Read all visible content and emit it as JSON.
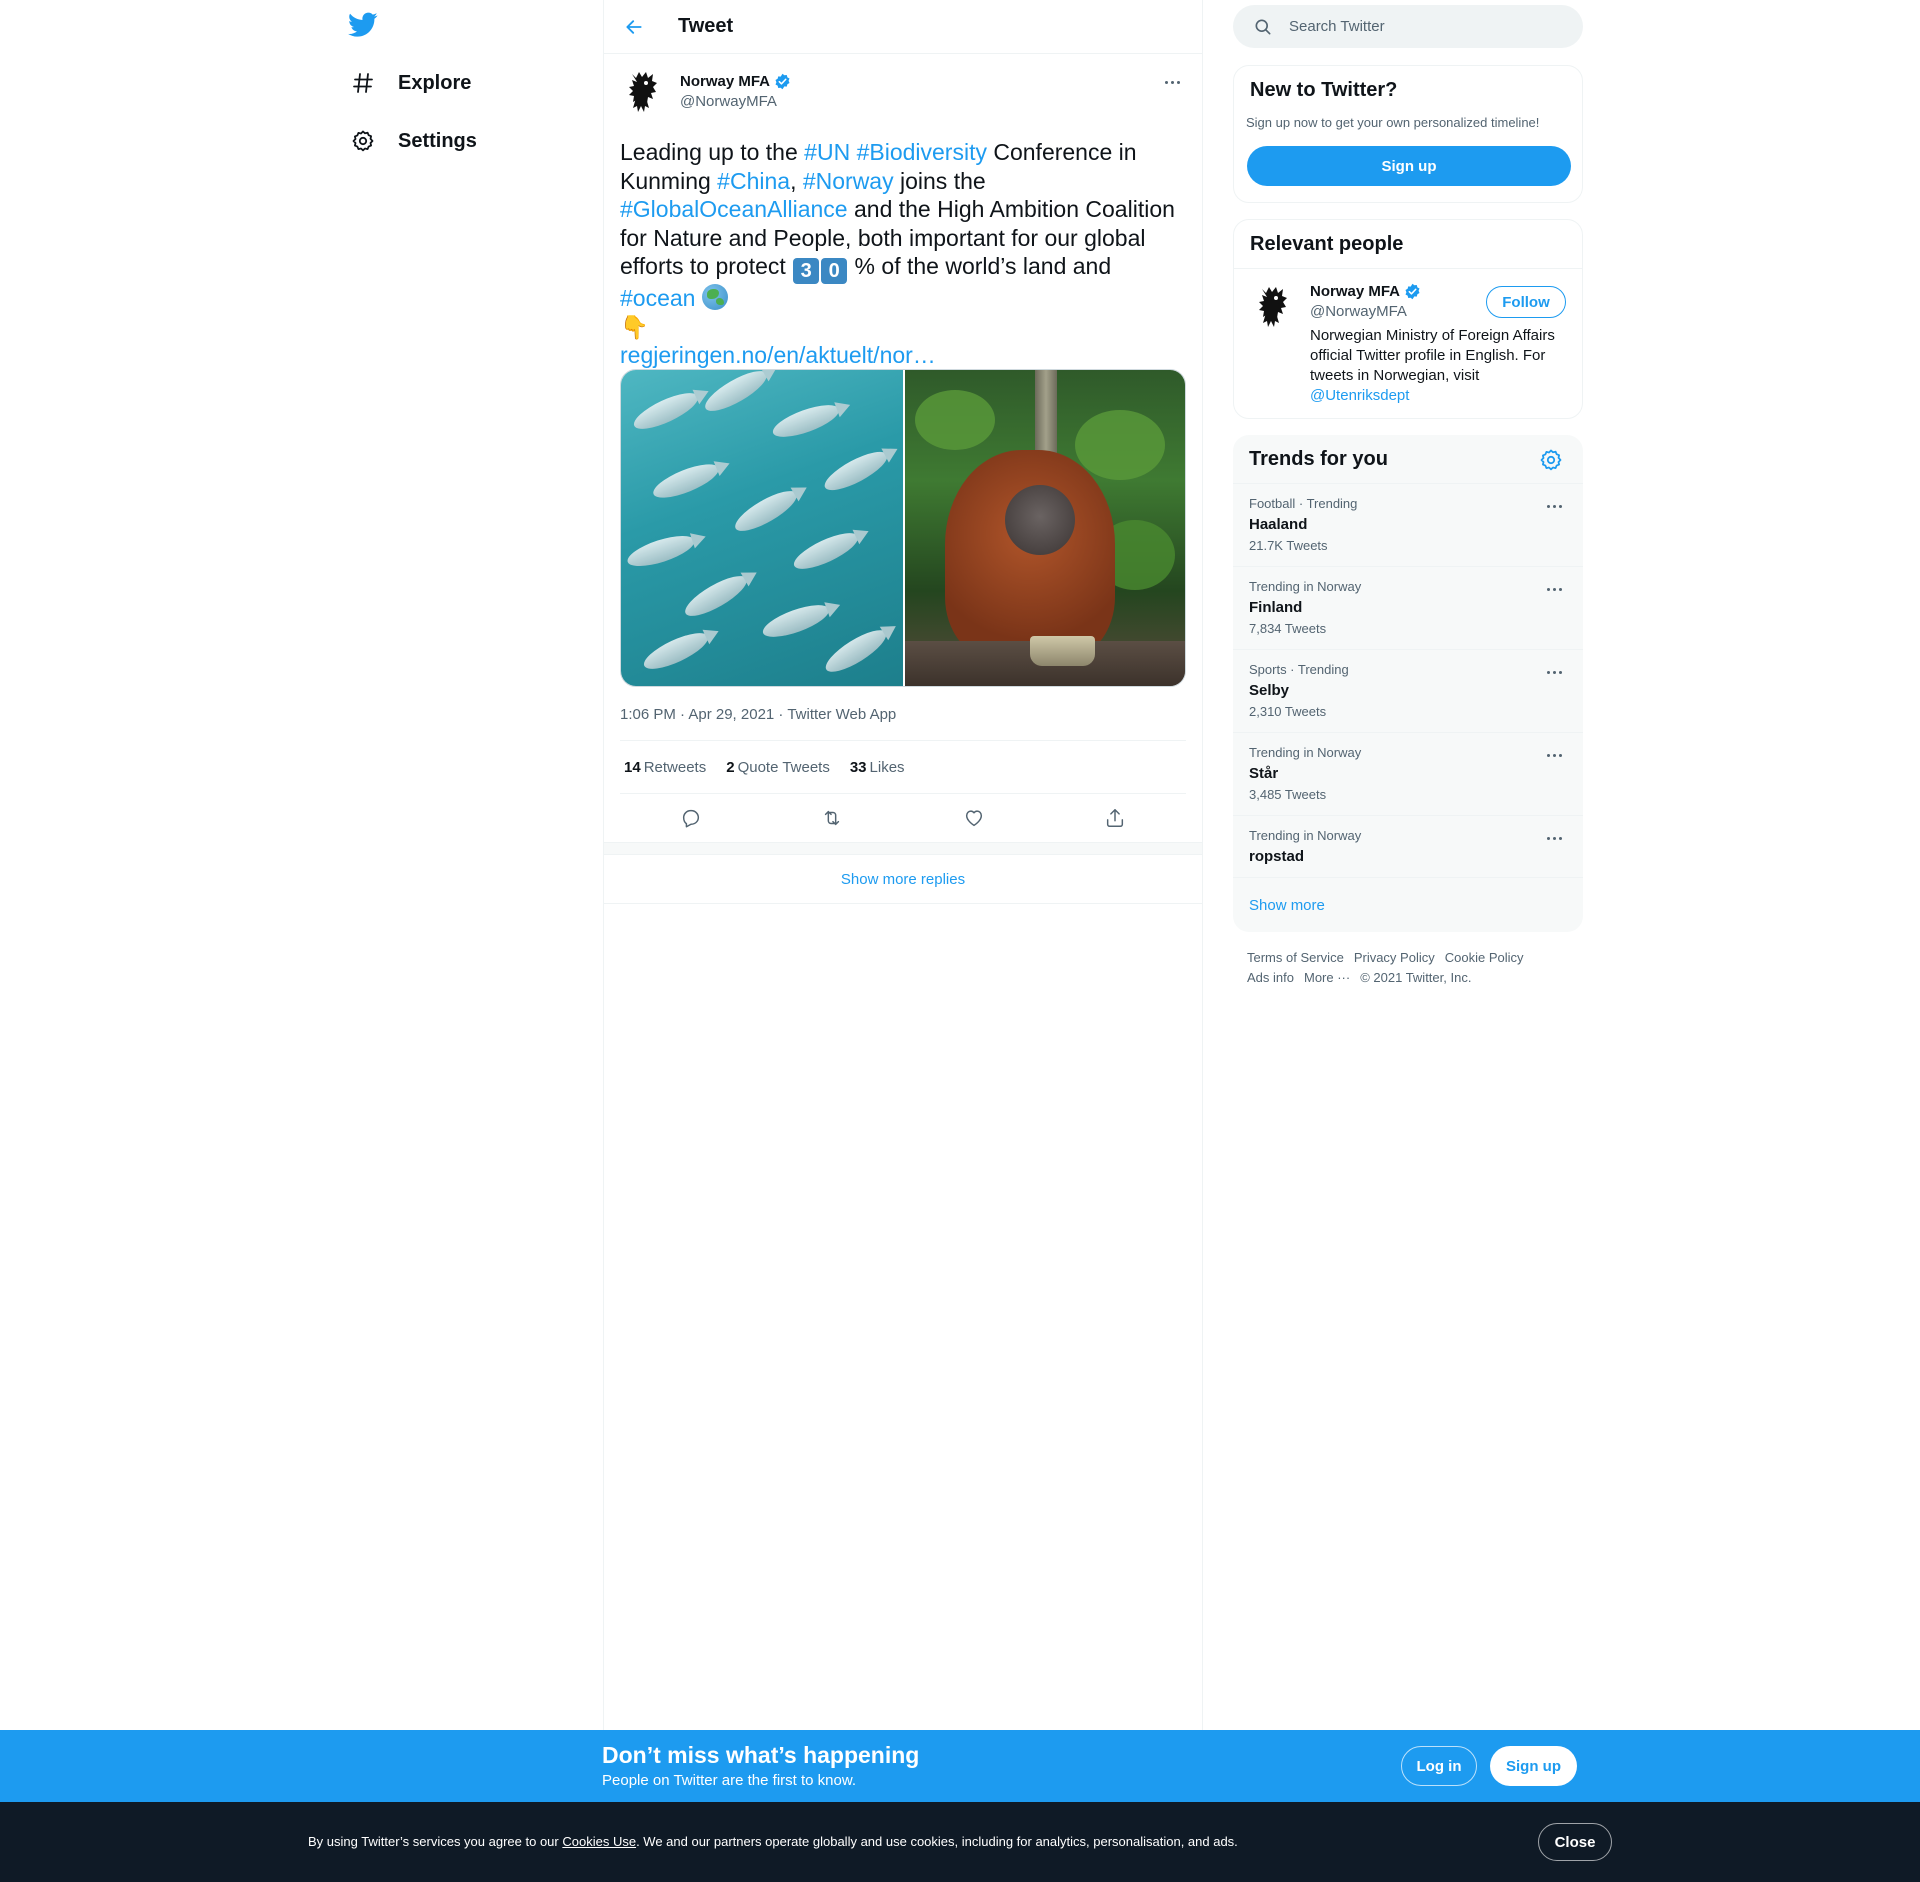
{
  "nav": {
    "logo": "twitter-bird-icon",
    "items": [
      {
        "label": "Explore",
        "icon": "hashtag-icon"
      },
      {
        "label": "Settings",
        "icon": "gear-icon"
      }
    ]
  },
  "header": {
    "title": "Tweet"
  },
  "tweet": {
    "author_name": "Norway MFA",
    "author_handle": "@NorwayMFA",
    "text": {
      "p1": "Leading up to the ",
      "tag_un": "#UN",
      "tag_biodiversity": "#Biodiversity",
      "p2": " Conference in Kunming ",
      "tag_china": "#China",
      "p3": ", ",
      "tag_norway": "#Norway",
      "p4": " joins the ",
      "tag_goa": "#GlobalOceanAlliance",
      "p5": " and the High Ambition Coalition for Nature and People,  both important for our global efforts to protect ",
      "key3": "3",
      "key0": "0",
      "p6": " % of the world’s land and ",
      "tag_ocean": "#ocean",
      "finger": "👇",
      "link": "regjeringen.no/en/aktuelt/nor…"
    },
    "meta": "1:06 PM · Apr 29, 2021 · Twitter Web App",
    "stats": {
      "retweets_count": "14",
      "retweets_label": "Retweets",
      "quotes_count": "2",
      "quotes_label": "Quote Tweets",
      "likes_count": "33",
      "likes_label": "Likes"
    },
    "show_more_replies": "Show more replies"
  },
  "search": {
    "placeholder": "Search Twitter"
  },
  "new_to_twitter": {
    "title": "New to Twitter?",
    "subtitle": "Sign up now to get your own personalized timeline!",
    "signup": "Sign up"
  },
  "relevant_people": {
    "title": "Relevant people",
    "name": "Norway MFA",
    "handle": "@NorwayMFA",
    "follow": "Follow",
    "bio": "Norwegian Ministry of Foreign Affairs official Twitter profile in English. For tweets in Norwegian, visit ",
    "bio_mention": "@Utenriksdept"
  },
  "trends": {
    "title": "Trends for you",
    "items": [
      {
        "context": "Football · Trending",
        "name": "Haaland",
        "count": "21.7K Tweets"
      },
      {
        "context": "Trending in Norway",
        "name": "Finland",
        "count": "7,834 Tweets"
      },
      {
        "context": "Sports · Trending",
        "name": "Selby",
        "count": "2,310 Tweets"
      },
      {
        "context": "Trending in Norway",
        "name": "Står",
        "count": "3,485 Tweets"
      },
      {
        "context": "Trending in Norway",
        "name": "ropstad",
        "count": ""
      }
    ],
    "show_more": "Show more"
  },
  "footer": {
    "terms": "Terms of Service",
    "privacy": "Privacy Policy",
    "cookie": "Cookie Policy",
    "ads": "Ads info",
    "more": "More ···",
    "copyright": "© 2021 Twitter, Inc."
  },
  "bottom_bar": {
    "title": "Don’t miss what’s happening",
    "subtitle": "People on Twitter are the first to know.",
    "login": "Log in",
    "signup": "Sign up"
  },
  "cookie_bar": {
    "text_before": "By using Twitter’s services you agree to our ",
    "link": "Cookies Use",
    "text_after": ". We and our partners operate globally and use cookies, including for analytics, personalisation, and ads.",
    "close": "Close"
  },
  "colors": {
    "accent": "#1d9bf0",
    "text": "#0f1419",
    "muted": "#536471",
    "cookie_bg": "#0f1a26"
  }
}
